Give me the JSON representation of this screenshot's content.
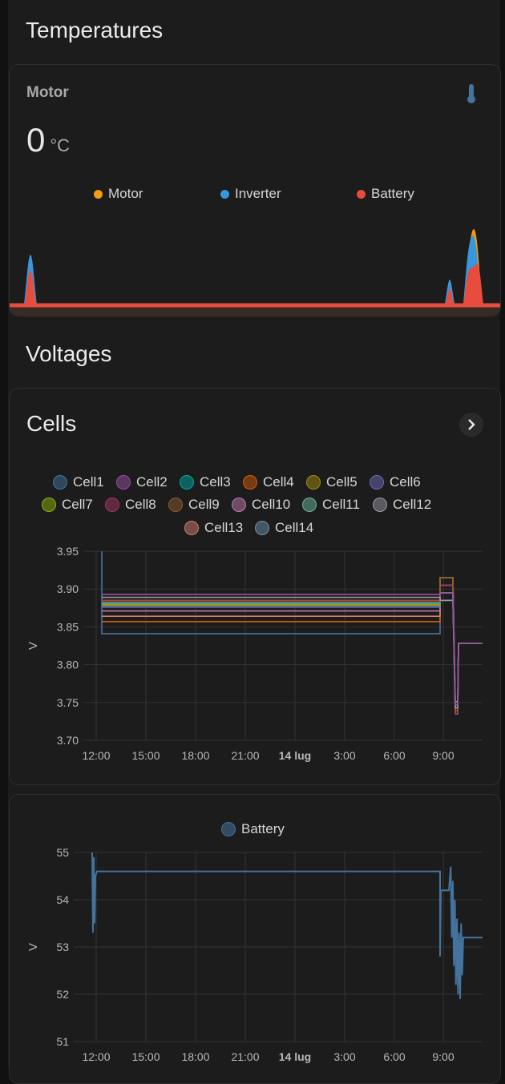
{
  "sections": {
    "temperatures": "Temperatures",
    "voltages": "Voltages"
  },
  "motor_card": {
    "name": "Motor",
    "value": "0",
    "unit": "°C",
    "icon": "thermometer-icon",
    "legend": [
      {
        "label": "Motor",
        "color": "#f59a14"
      },
      {
        "label": "Inverter",
        "color": "#3896dc"
      },
      {
        "label": "Battery",
        "color": "#e74c3c"
      }
    ]
  },
  "cells_card": {
    "title": "Cells",
    "legend": [
      {
        "label": "Cell1",
        "color": "#44739e"
      },
      {
        "label": "Cell2",
        "color": "#984ea3"
      },
      {
        "label": "Cell3",
        "color": "#00a79d"
      },
      {
        "label": "Cell4",
        "color": "#d35c0a"
      },
      {
        "label": "Cell5",
        "color": "#a38c0c"
      },
      {
        "label": "Cell6",
        "color": "#6b6ab9"
      },
      {
        "label": "Cell7",
        "color": "#8cb30c"
      },
      {
        "label": "Cell8",
        "color": "#a33561"
      },
      {
        "label": "Cell9",
        "color": "#8c5a30"
      },
      {
        "label": "Cell10",
        "color": "#c17ab0"
      },
      {
        "label": "Cell11",
        "color": "#6fb5a0"
      },
      {
        "label": "Cell12",
        "color": "#9a96a6"
      },
      {
        "label": "Cell13",
        "color": "#d37e6e"
      },
      {
        "label": "Cell14",
        "color": "#6f8ea8"
      }
    ]
  },
  "battery_card": {
    "legend": [
      {
        "label": "Battery",
        "color": "#44739e"
      }
    ]
  },
  "chart_data": [
    {
      "type": "area",
      "series": [
        {
          "name": "Motor",
          "peaks": [
            {
              "t": "12:20",
              "v": 0
            },
            {
              "t": "09:05",
              "v": 8
            },
            {
              "t": "09:35",
              "v": 95
            }
          ]
        },
        {
          "name": "Inverter",
          "peaks": [
            {
              "t": "12:20",
              "v": 65
            },
            {
              "t": "09:05",
              "v": 33
            },
            {
              "t": "09:35",
              "v": 85
            }
          ]
        },
        {
          "name": "Battery",
          "peaks": [
            {
              "t": "12:20",
              "v": 45
            },
            {
              "t": "09:05",
              "v": 22
            },
            {
              "t": "09:35",
              "v": 48
            }
          ]
        }
      ]
    },
    {
      "type": "line",
      "ylabel": "V",
      "yticks": [
        "3.95",
        "3.90",
        "3.85",
        "3.80",
        "3.75",
        "3.70"
      ],
      "ylim": [
        3.7,
        3.95
      ],
      "xticks": [
        "12:00",
        "15:00",
        "18:00",
        "21:00",
        "14 lug",
        "3:00",
        "6:00",
        "9:00"
      ],
      "plateau_levels": [
        3.841,
        3.857,
        3.864,
        3.871,
        3.876,
        3.878,
        3.879,
        3.88,
        3.881,
        3.882,
        3.883,
        3.885,
        3.889,
        3.893
      ],
      "late_level": 3.828,
      "dip_level": 3.735
    },
    {
      "type": "line",
      "ylabel": "V",
      "yticks": [
        "55",
        "54",
        "53",
        "52",
        "51"
      ],
      "ylim": [
        51,
        55
      ],
      "xticks": [
        "12:00",
        "15:00",
        "18:00",
        "21:00",
        "14 lug",
        "3:00",
        "6:00",
        "9:00"
      ],
      "series": [
        {
          "name": "Battery",
          "plateau": 54.6,
          "drop_level": 54.2,
          "min": 51.9,
          "final": 53.2
        }
      ]
    }
  ]
}
